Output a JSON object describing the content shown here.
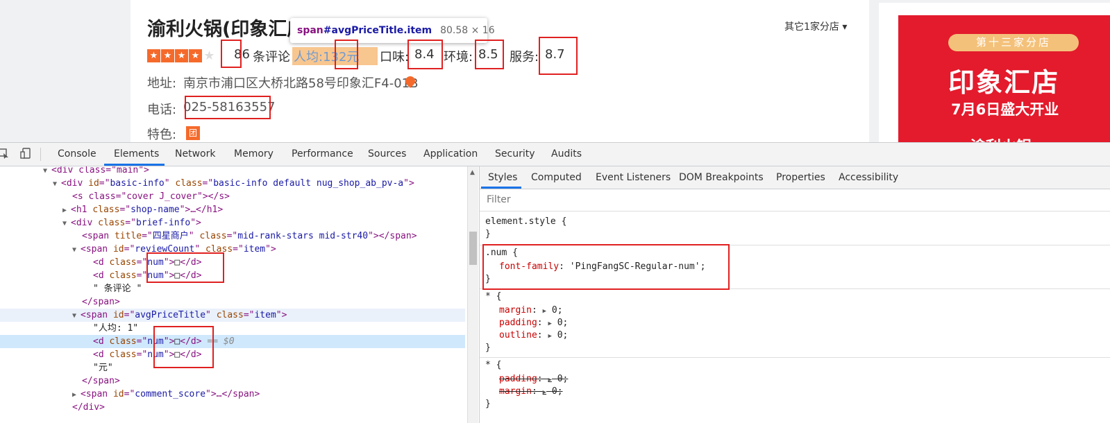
{
  "shop": {
    "name": "渝利火锅(印象汇店",
    "branch_label": "其它1家分店 ▾",
    "star_glyph": "★",
    "review_count": "86",
    "review_label": "条评论",
    "avg_label": "人均:",
    "avg_value": "132元",
    "taste_label": "口味:",
    "taste_value": "8.4",
    "env_label": "环境:",
    "env_value": "8.5",
    "service_label": "服务:",
    "service_value": "8.7",
    "address_label": "地址:",
    "address_value": "南京市浦口区大桥北路58号印象汇F4-01B",
    "phone_label": "电话:",
    "phone_value": "025-58163557",
    "feature_label": "特色:",
    "feature_badge": "团",
    "rating_stars": 4,
    "rating_max": 5
  },
  "tooltip": {
    "tag": "span",
    "selector": "#avgPriceTitle.item",
    "size": "80.58 × 16"
  },
  "ad": {
    "pill": "第十三家分店",
    "title": "印象汇店",
    "subtitle": "7月6日盛大开业",
    "cut_text": "渝利火锅"
  },
  "devtools": {
    "tabs": [
      "Console",
      "Elements",
      "Network",
      "Memory",
      "Performance",
      "Sources",
      "Application",
      "Security",
      "Audits"
    ],
    "active_tab": "Elements",
    "styles_tabs": [
      "Styles",
      "Computed",
      "Event Listeners",
      "DOM Breakpoints",
      "Properties",
      "Accessibility"
    ],
    "styles_active": "Styles",
    "filter_placeholder": "Filter",
    "dom": {
      "l0": "<div class=\"main\">",
      "l1_tag": "div",
      "l1_id": "basic-info",
      "l1_class": "basic-info default nug_shop_ab_pv-a",
      "l2": "<s class=\"cover J_cover\"></s>",
      "l3_tag": "h1",
      "l3_class": "shop-name",
      "l3_rest": ">…</h1>",
      "l4_class": "brief-info",
      "l5_title": "四星商户",
      "l5_class": "mid-rank-stars mid-str40",
      "l6_id": "reviewCount",
      "l6_class": "item",
      "num_class": "num",
      "num_glyph": "□",
      "review_text": "\" 条评论 \"",
      "span_close": "</span>",
      "avg_id": "avgPriceTitle",
      "avg_class": "item",
      "avg_text1": "\"人均: 1\"",
      "selected_marker": "== $0",
      "avg_text2": "\"元\"",
      "score_id": "comment_score",
      "div_close": "</div>"
    },
    "styles": {
      "r1_selector": "element.style {",
      "r1_close": "}",
      "r2_selector": ".num {",
      "r2_prop": "font-family",
      "r2_value": "'PingFangSC-Regular-num';",
      "r2_close": "}",
      "r3_selector": "* {",
      "r3_p1": "margin",
      "r3_v1": "0;",
      "r3_p2": "padding",
      "r3_v2": "0;",
      "r3_p3": "outline",
      "r3_v3": "0;",
      "r3_close": "}",
      "r4_selector": "* {",
      "r4_p1": "padding",
      "r4_v1": "0;",
      "r4_p2": "margin",
      "r4_v2": "0;",
      "r4_close": "}"
    }
  },
  "colors": {
    "accent_orange": "#f56a2b",
    "annotation_red": "#e02020",
    "devtools_blue": "#1a73e8"
  }
}
